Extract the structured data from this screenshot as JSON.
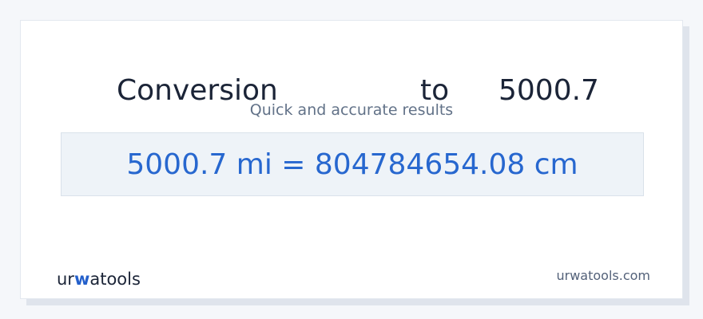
{
  "header": {
    "label_conversion": "Conversion",
    "label_to": "to",
    "input_value": "5000.7",
    "subtitle": "Quick and accurate results"
  },
  "result": {
    "text": "5000.7 mi = 804784654.08 cm"
  },
  "brand": {
    "logo_before": "ur",
    "logo_mark": "w",
    "logo_after": "atools",
    "site": "urwatools.com"
  },
  "colors": {
    "primary": "#2767cf",
    "title": "#1b2437",
    "subtitle": "#627288",
    "result_bg": "#eef3f8"
  }
}
